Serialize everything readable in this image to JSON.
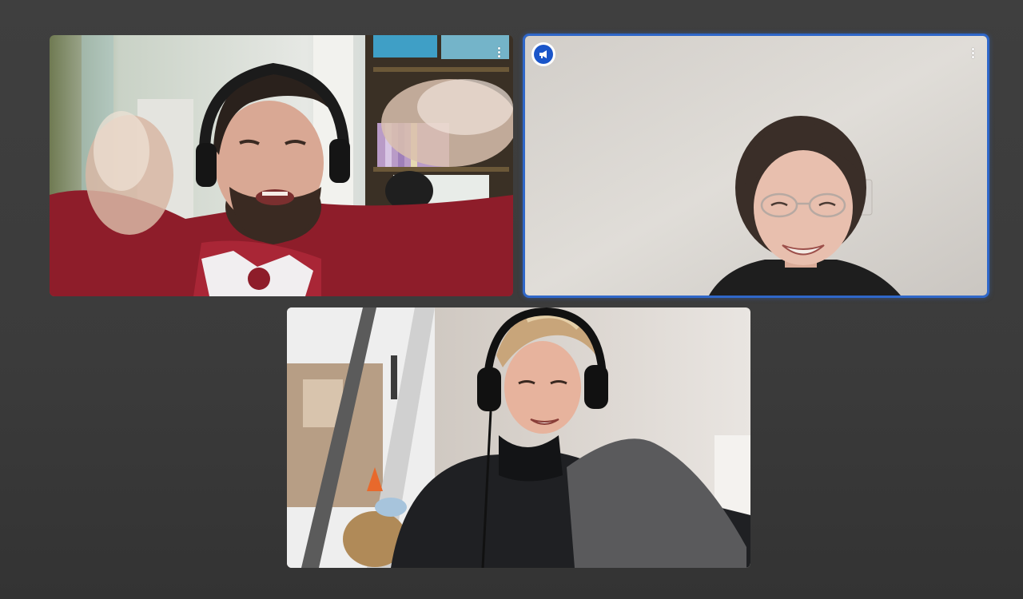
{
  "call": {
    "background_color": "#3c3c3c",
    "active_speaker_border_color": "#2f67c9",
    "participants": [
      {
        "tile_id": "tile-1",
        "options_icon": "more-vertical-icon",
        "active_speaker": false
      },
      {
        "tile_id": "tile-2",
        "options_icon": "more-vertical-icon",
        "active_speaker": true,
        "badge_icon": "megaphone-icon",
        "badge_color": "#1a55c9"
      },
      {
        "tile_id": "tile-3",
        "options_icon": "more-vertical-icon",
        "active_speaker": false
      }
    ]
  }
}
